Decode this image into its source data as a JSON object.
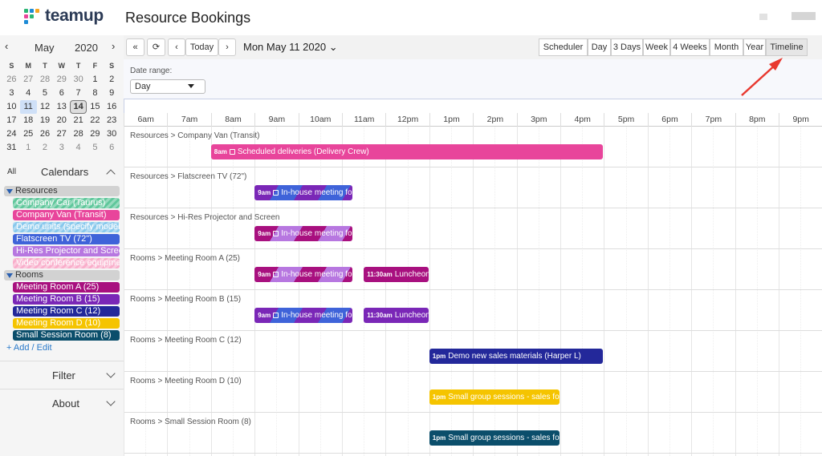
{
  "app": {
    "brand": "teamup",
    "title": "Resource Bookings"
  },
  "mini_calendar": {
    "month": "May",
    "year": "2020",
    "weekdays": [
      "S",
      "M",
      "T",
      "W",
      "T",
      "F",
      "S"
    ],
    "weeks": [
      [
        "26",
        "27",
        "28",
        "29",
        "30",
        "1",
        "2"
      ],
      [
        "3",
        "4",
        "5",
        "6",
        "7",
        "8",
        "9"
      ],
      [
        "10",
        "11",
        "12",
        "13",
        "14",
        "15",
        "16"
      ],
      [
        "17",
        "18",
        "19",
        "20",
        "21",
        "22",
        "23"
      ],
      [
        "24",
        "25",
        "26",
        "27",
        "28",
        "29",
        "30"
      ],
      [
        "31",
        "1",
        "2",
        "3",
        "4",
        "5",
        "6"
      ]
    ],
    "selected_day": "11",
    "today": "14"
  },
  "sidebar": {
    "all_label": "All",
    "calendars_label": "Calendars",
    "groups": [
      {
        "name": "Resources",
        "items": [
          {
            "label": "Company Car (Taurus)",
            "color": "#5fc79b",
            "hatched": true
          },
          {
            "label": "Company Van (Transit)",
            "color": "#e8459b",
            "hatched": false
          },
          {
            "label": "Demo units (specify model)",
            "color": "#88c8ec",
            "hatched": true
          },
          {
            "label": "Flatscreen TV (72\")",
            "color": "#3f63d9",
            "hatched": false
          },
          {
            "label": "Hi-Res Projector and Screen",
            "color": "#b777e0",
            "hatched": false
          },
          {
            "label": "Video conference equipment",
            "color": "#f9aecb",
            "hatched": true
          }
        ]
      },
      {
        "name": "Rooms",
        "items": [
          {
            "label": "Meeting Room A (25)",
            "color": "#a8107f",
            "hatched": false
          },
          {
            "label": "Meeting Room B (15)",
            "color": "#7a27b7",
            "hatched": false
          },
          {
            "label": "Meeting Room C (12)",
            "color": "#23289a",
            "hatched": false
          },
          {
            "label": "Meeting Room D (10)",
            "color": "#f5c400",
            "hatched": false
          },
          {
            "label": "Small Session Room (8)",
            "color": "#0b4e6b",
            "hatched": false
          }
        ]
      }
    ],
    "add_edit": "+ Add / Edit",
    "filter_label": "Filter",
    "about_label": "About"
  },
  "toolbar": {
    "today": "Today",
    "date": "Mon May 11 2020",
    "views": [
      "Scheduler",
      "Day",
      "3 Days",
      "Week",
      "4 Weeks",
      "Month",
      "Year",
      "Timeline"
    ],
    "active_view": "Timeline"
  },
  "date_range": {
    "label": "Date range:",
    "value": "Day"
  },
  "timeline": {
    "hours": [
      "6am",
      "7am",
      "8am",
      "9am",
      "10am",
      "11am",
      "12pm",
      "1pm",
      "2pm",
      "3pm",
      "4pm",
      "5pm",
      "6pm",
      "7pm",
      "8pm",
      "9pm"
    ],
    "lanes": [
      {
        "label": "Resources > Company Van (Transit)",
        "events": [
          {
            "time": "8am",
            "title": "Scheduled deliveries (Delivery Crew)",
            "start": 8,
            "end": 17,
            "color": "#e8459b",
            "icon": "repeat-icon"
          }
        ]
      },
      {
        "label": "Resources > Flatscreen TV (72\")",
        "events": [
          {
            "time": "9am",
            "title": "In-house meeting for",
            "start": 9,
            "end": 11.25,
            "color": "#3f63d9",
            "icon": "copy-icon",
            "split": "#7a27b7"
          }
        ]
      },
      {
        "label": "Resources > Hi-Res Projector and Screen",
        "events": [
          {
            "time": "9am",
            "title": "In-house meeting for",
            "start": 9,
            "end": 11.25,
            "color": "#b777e0",
            "icon": "copy-icon",
            "split": "#a8107f"
          }
        ]
      },
      {
        "label": "Rooms > Meeting Room A (25)",
        "events": [
          {
            "time": "9am",
            "title": "In-house meeting for",
            "start": 9,
            "end": 11.25,
            "color": "#b777e0",
            "icon": "copy-icon",
            "split": "#a8107f"
          },
          {
            "time": "11:30am",
            "title": "Luncheon",
            "start": 11.5,
            "end": 13,
            "color": "#a8107f",
            "icon": ""
          }
        ]
      },
      {
        "label": "Rooms > Meeting Room B (15)",
        "events": [
          {
            "time": "9am",
            "title": "In-house meeting for",
            "start": 9,
            "end": 11.25,
            "color": "#3f63d9",
            "icon": "copy-icon",
            "split": "#7a27b7"
          },
          {
            "time": "11:30am",
            "title": "Luncheon",
            "start": 11.5,
            "end": 13,
            "color": "#7a27b7",
            "icon": ""
          }
        ]
      },
      {
        "label": "Rooms > Meeting Room C (12)",
        "events": [
          {
            "time": "1pm",
            "title": "Demo new sales materials (Harper L)",
            "start": 13,
            "end": 17,
            "color": "#23289a",
            "icon": ""
          }
        ]
      },
      {
        "label": "Rooms > Meeting Room D (10)",
        "events": [
          {
            "time": "1pm",
            "title": "Small group sessions - sales focus",
            "start": 13,
            "end": 16,
            "color": "#f5c400",
            "icon": ""
          }
        ]
      },
      {
        "label": "Rooms > Small Session Room (8)",
        "events": [
          {
            "time": "1pm",
            "title": "Small group sessions - sales focus",
            "start": 13,
            "end": 16,
            "color": "#0b4e6b",
            "icon": ""
          }
        ]
      }
    ]
  },
  "colors": {
    "accent": "#e8382f",
    "logo": [
      "#2bb673",
      "#1e8bd6",
      "#f5a623",
      "#e8459b"
    ]
  }
}
